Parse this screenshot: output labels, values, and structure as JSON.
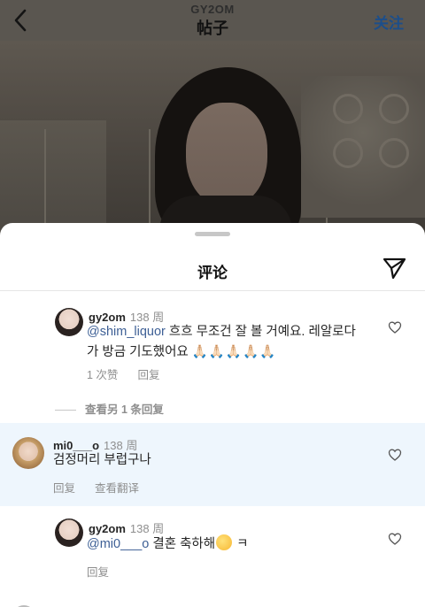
{
  "header": {
    "username": "GY2OM",
    "title": "帖子",
    "follow_label": "关注"
  },
  "sheet": {
    "title": "评论"
  },
  "comments": [
    {
      "user": "gy2om",
      "time": "138 周",
      "mention": "@shim_liquor",
      "text": " 흐흐 무조건 잘 볼 거예요. 레알로다",
      "text2": "가 방금 기도했어요 ",
      "emoji": "🙏🏻🙏🏻🙏🏻🙏🏻🙏🏻",
      "likes": "1 次赞",
      "reply_label": "回复"
    },
    {
      "user": "mi0___o",
      "time": "138 周",
      "text": "검정머리 부럽구나",
      "reply_label": "回复",
      "translate_label": "查看翻译"
    },
    {
      "user": "gy2om",
      "time": "138 周",
      "mention": "@mi0___o",
      "text": " 결혼 축하해",
      "text_end": " ㅋ",
      "reply_label": "回复"
    }
  ],
  "view_replies": "查看另 1 条回复",
  "icons": {
    "back": "chevron-left-icon",
    "share": "paper-plane-icon",
    "heart": "heart-outline-icon"
  },
  "colors": {
    "mention": "#3d5f95",
    "follow": "#1c4e8a",
    "highlight": "#eef6fd"
  }
}
